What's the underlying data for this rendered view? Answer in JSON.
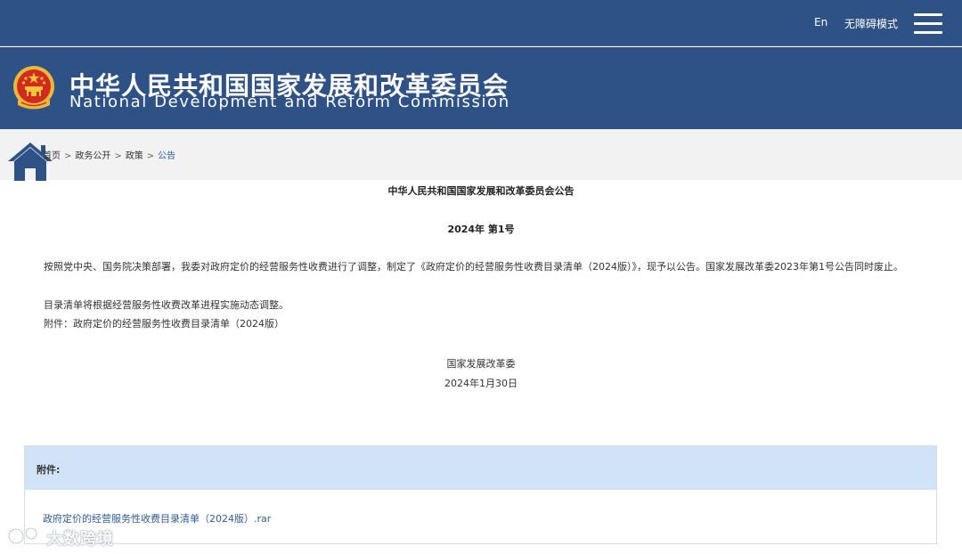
{
  "header": {
    "lang_label": "En",
    "accessibility_label": "无障碍模式",
    "title_cn": "中华人民共和国国家发展和改革委员会",
    "title_en": "National Development and Reform Commission"
  },
  "breadcrumb": [
    {
      "label": "首页"
    },
    {
      "label": "政务公开"
    },
    {
      "label": "政策"
    },
    {
      "label": "公告"
    }
  ],
  "breadcrumb_sep": ">",
  "article": {
    "title": "中华人民共和国国家发展和改革委员会公告",
    "number": "2024年 第1号",
    "paragraphs": [
      "按照党中央、国务院决策部署，我委对政府定价的经营服务性收费进行了调整，制定了《政府定价的经营服务性收费目录清单（2024版）》，现予以公告。国家发展改革委2023年第1号公告同时废止。",
      "目录清单将根据经营服务性收费改革进程实施动态调整。",
      "附件：政府定价的经营服务性收费目录清单（2024版）"
    ],
    "signature": "国家发展改革委",
    "date": "2024年1月30日"
  },
  "attachments": {
    "label": "附件:",
    "files": [
      "政府定价的经营服务性收费目录清单（2024版）.rar"
    ]
  },
  "watermark": {
    "text": "大数跨境"
  },
  "colors": {
    "header_bg": "#2f5286",
    "breadcrumb_bg": "#f2f2f2",
    "attachment_head_bg": "#d1e4f7",
    "link": "#2f5b9a"
  },
  "icons": [
    "national-emblem-icon",
    "home-icon",
    "menu-icon",
    "watermark-logo-icon"
  ]
}
